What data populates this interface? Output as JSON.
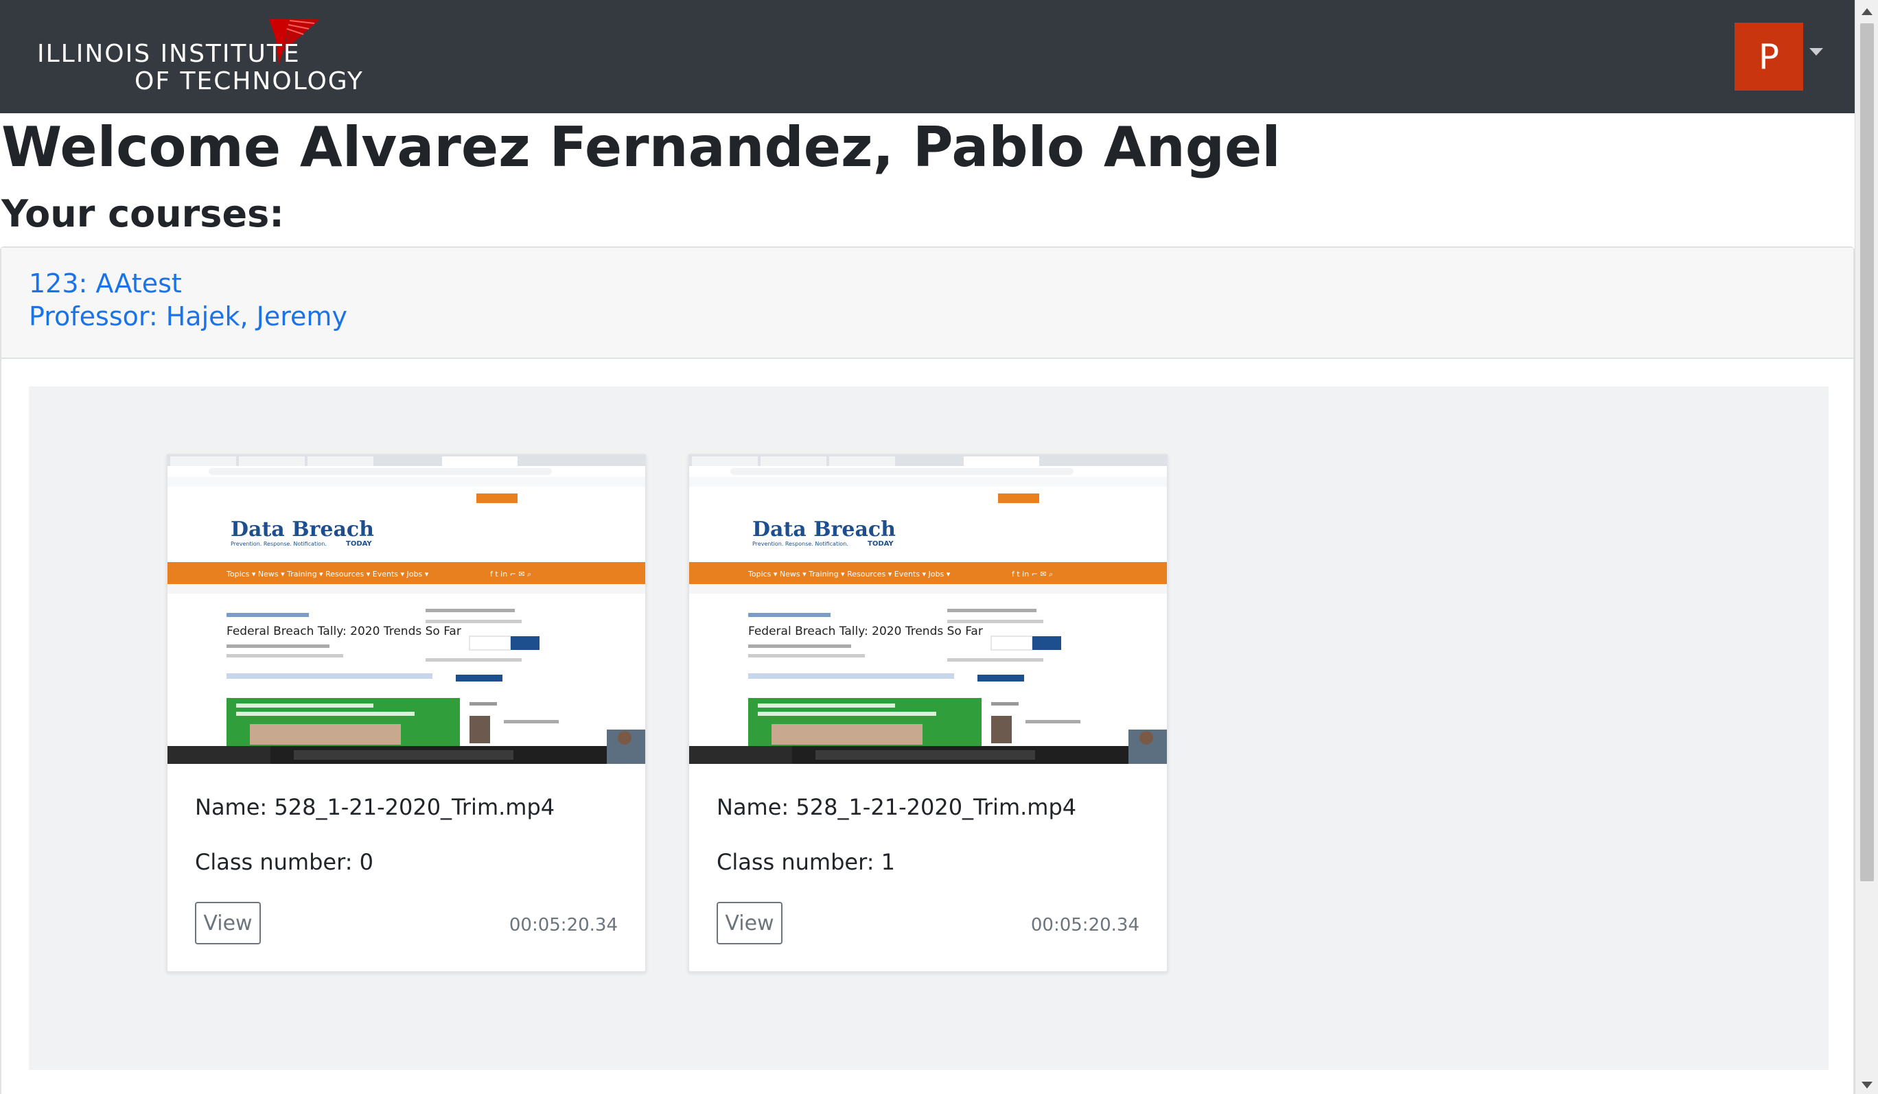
{
  "navbar": {
    "logo_line1": "ILLINOIS INSTITUTE",
    "logo_line2": "OF TECHNOLOGY",
    "avatar_initial": "P",
    "avatar_color": "#c8350f"
  },
  "page": {
    "welcome": "Welcome Alvarez Fernandez, Pablo Angel",
    "courses_heading": "Your courses:"
  },
  "course": {
    "title": "123: AAtest",
    "professor": "Professor: Hajek, Jeremy"
  },
  "videos": [
    {
      "name": "Name: 528_1-21-2020_Trim.mp4",
      "class_number": "Class number: 0",
      "view_label": "View",
      "duration": "00:05:20.34"
    },
    {
      "name": "Name: 528_1-21-2020_Trim.mp4",
      "class_number": "Class number: 1",
      "view_label": "View",
      "duration": "00:05:20.34"
    }
  ],
  "thumbnail": {
    "site_name": "Data Breach",
    "site_tag": "TODAY",
    "headline": "Federal Breach Tally: 2020 Trends So Far",
    "accent_color": "#e8801f"
  }
}
